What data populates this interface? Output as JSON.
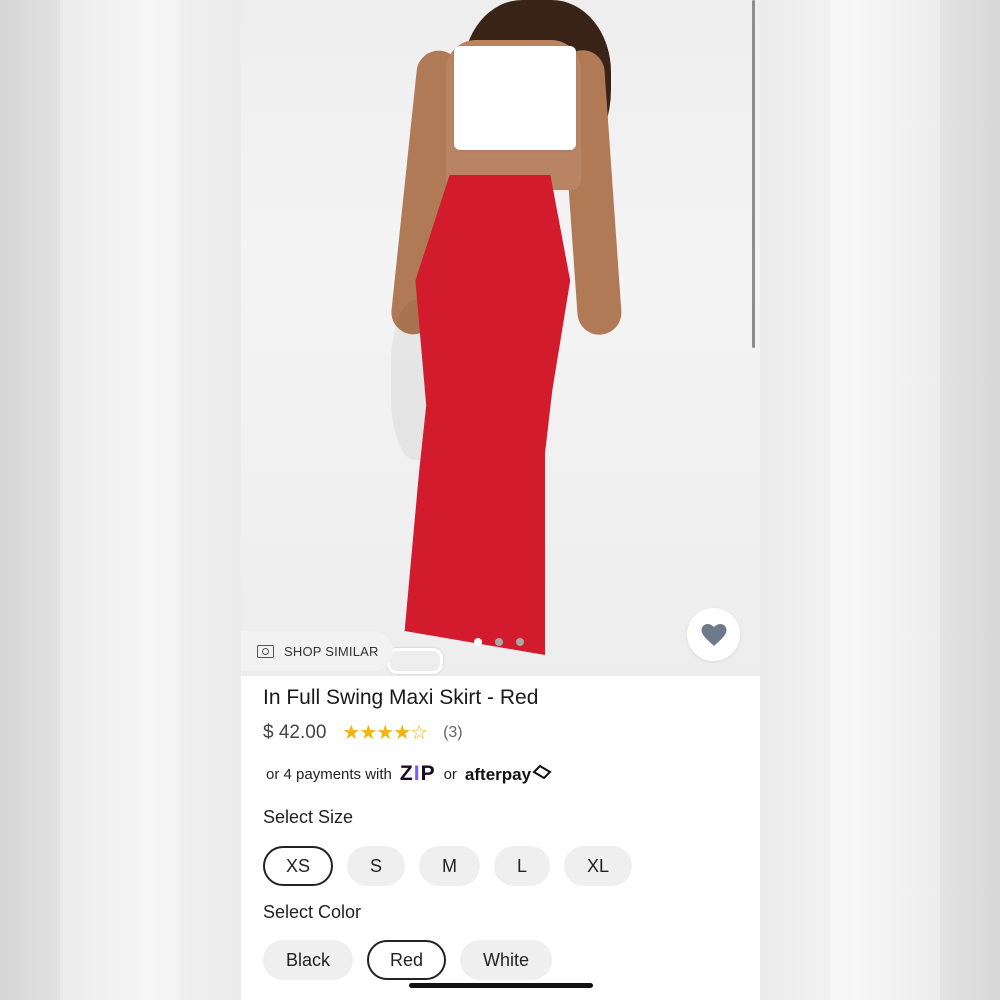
{
  "product": {
    "title": "In Full Swing Maxi Skirt - Red",
    "price": "$ 42.00",
    "rating_stars": "★★★★☆",
    "rating_count": "(3)",
    "rating_value": 3.5
  },
  "hero": {
    "shop_similar_label": "SHOP SIMILAR",
    "shop_similar_icon": "camera-scan-icon",
    "favorite_icon": "heart-icon",
    "carousel_total": 3,
    "carousel_active_index": 0
  },
  "payment": {
    "prefix": "or 4 payments with",
    "zip_logo": "ZIP",
    "middle": "or",
    "afterpay_logo": "afterpay"
  },
  "size": {
    "label": "Select Size",
    "options": [
      "XS",
      "S",
      "M",
      "L",
      "XL"
    ],
    "selected": "XS"
  },
  "color": {
    "label": "Select Color",
    "options": [
      "Black",
      "Red",
      "White"
    ],
    "selected": "Red"
  },
  "colors": {
    "skirt": "#d21b2c",
    "star": "#f3b40f",
    "heart": "#6d7a8a",
    "zip_accent": "#7a5af8"
  }
}
